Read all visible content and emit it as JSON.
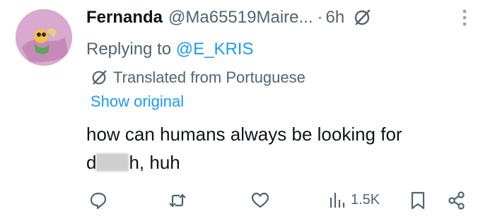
{
  "tweet": {
    "display_name": "Fernanda",
    "handle": "@Ma65519Maire...",
    "separator": "·",
    "time": "6h",
    "replying_prefix": "Replying to ",
    "replying_to": "@E_KRIS",
    "translated_label": "Translated from Portuguese",
    "show_original": "Show original",
    "text_line1": "how can humans always be looking for",
    "text_line2_start": "d",
    "text_line2_end": "h, huh"
  },
  "actions": {
    "views": "1.5K"
  },
  "icons": {
    "grok": "grok-slash-icon",
    "more": "more-vertical-icon",
    "reply": "reply-bubble-icon",
    "retweet": "retweet-icon",
    "like": "heart-icon",
    "views": "bar-chart-icon",
    "bookmark": "bookmark-icon",
    "share": "share-icon"
  },
  "colors": {
    "text": "#0f1419",
    "secondary": "#536471",
    "link": "#1d9bf0",
    "avatar_bg": "#d9a9cf"
  }
}
